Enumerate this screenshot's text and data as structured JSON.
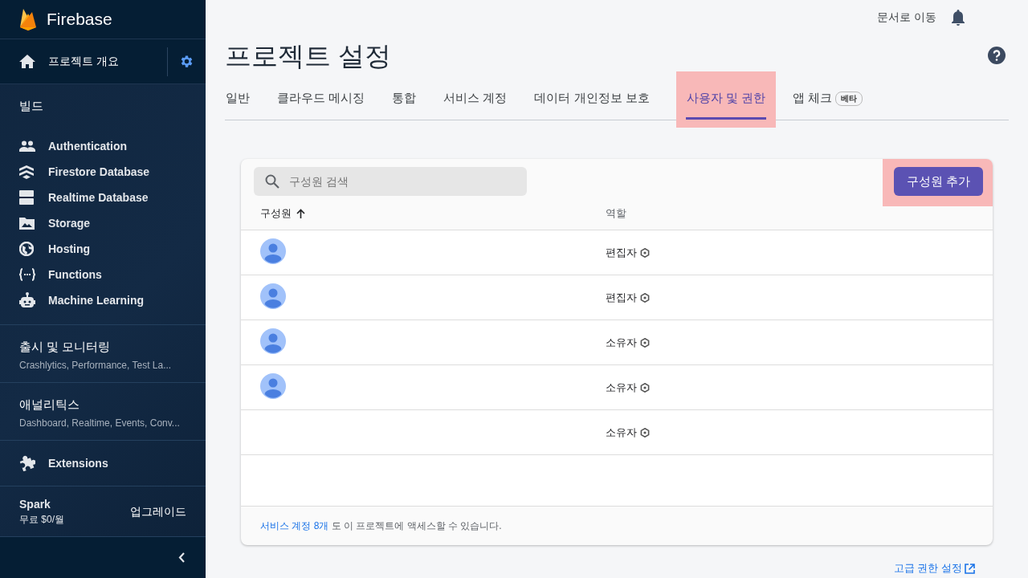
{
  "sidebar": {
    "brand": "Firebase",
    "overview": {
      "label": "프로젝트 개요"
    },
    "sections": [
      {
        "kind": "group",
        "title": "빌드",
        "items": [
          {
            "label": "Authentication",
            "kind": "people"
          },
          {
            "label": "Firestore Database",
            "kind": "firestore"
          },
          {
            "label": "Realtime Database",
            "kind": "database"
          },
          {
            "label": "Storage",
            "kind": "photo"
          },
          {
            "label": "Hosting",
            "kind": "globe"
          },
          {
            "label": "Functions",
            "kind": "braces"
          },
          {
            "label": "Machine Learning",
            "kind": "robot"
          }
        ]
      },
      {
        "kind": "summary",
        "title": "출시 및 모니터링",
        "subtitle": "Crashlytics, Performance, Test La..."
      },
      {
        "kind": "summary",
        "title": "애널리틱스",
        "subtitle": "Dashboard, Realtime, Events, Conv..."
      },
      {
        "kind": "link",
        "items": [
          {
            "label": "Extensions",
            "kind": "puzzle"
          }
        ]
      }
    ],
    "plan": {
      "name": "Spark",
      "price": "무료 $0/월",
      "action": "업그레이드"
    }
  },
  "topbar": {
    "docs_link": "문서로 이동"
  },
  "page": {
    "title": "프로젝트 설정"
  },
  "tabs": [
    {
      "label": "일반",
      "selected": false
    },
    {
      "label": "클라우드 메시징",
      "selected": false
    },
    {
      "label": "통합",
      "selected": false
    },
    {
      "label": "서비스 계정",
      "selected": false
    },
    {
      "label": "데이터 개인정보 보호",
      "selected": false
    },
    {
      "label": "사용자 및 권한",
      "selected": true
    },
    {
      "label": "앱 체크",
      "badge": "베타",
      "selected": false
    }
  ],
  "members": {
    "search": {
      "placeholder": "구성원 검색"
    },
    "add_button": "구성원 추가",
    "columns": [
      {
        "label": "구성원",
        "sorted": true
      },
      {
        "label": "역할",
        "sorted": false
      }
    ],
    "rows": [
      {
        "avatar": true,
        "role": "편집자"
      },
      {
        "avatar": true,
        "role": "편집자"
      },
      {
        "avatar": true,
        "role": "소유자"
      },
      {
        "avatar": true,
        "role": "소유자"
      },
      {
        "avatar": false,
        "role": "소유자"
      }
    ],
    "footer": {
      "link": "서비스 계정 8개",
      "text": " 도 이 프로젝트에 액세스할 수 있습니다."
    }
  },
  "advanced_link": "고급 권한 설정"
}
